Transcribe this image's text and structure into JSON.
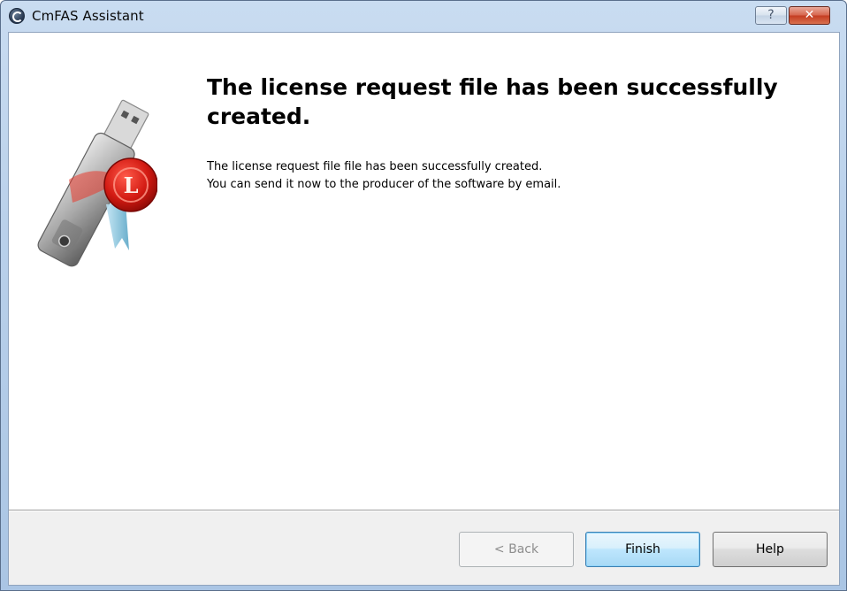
{
  "window": {
    "title": "CmFAS Assistant",
    "help_button_glyph": "?",
    "close_button_glyph": "✕"
  },
  "content": {
    "heading": "The license request file has been successfully created.",
    "body_line1": "The license request file file has been successfully created.",
    "body_line2": "You can send it now to the producer of the software by email.",
    "illustration": "usb-stick-with-license-seal-icon"
  },
  "buttons": {
    "back": "< Back",
    "finish": "Finish",
    "help": "Help"
  },
  "colors": {
    "titlebar": "#b9d0ea",
    "close_button": "#c43c22",
    "footer": "#f0f0f0",
    "default_button_border": "#3c7fb1",
    "disabled_text": "#8d8d8d"
  }
}
